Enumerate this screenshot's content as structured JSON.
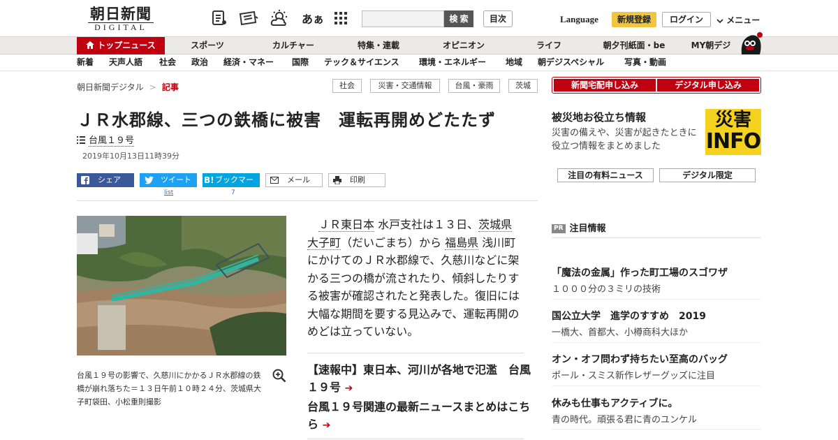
{
  "header": {
    "logo_main": "朝日新聞",
    "logo_sub": "DIGITAL",
    "search_label": "検 索",
    "search_placeholder": "",
    "toc_label": "目次",
    "font_icon_text": "あぁ",
    "language": "Language",
    "register": "新規登録",
    "login": "ログイン",
    "menu": "メニュー"
  },
  "nav1": [
    {
      "label": "トップニュース"
    },
    {
      "label": "スポーツ"
    },
    {
      "label": "カルチャー"
    },
    {
      "label": "特集・連載"
    },
    {
      "label": "オピニオン"
    },
    {
      "label": "ライフ"
    },
    {
      "label": "朝夕刊紙面・be"
    },
    {
      "label": "MY朝デジ"
    }
  ],
  "nav2": [
    {
      "label": "新着"
    },
    {
      "label": "天声人語"
    },
    {
      "label": "社会"
    },
    {
      "label": "政治"
    },
    {
      "label": "経済・マネー"
    },
    {
      "label": "国際"
    },
    {
      "label": "テック＆サイエンス"
    },
    {
      "label": "環境・エネルギー"
    },
    {
      "label": "地域"
    },
    {
      "label": "朝デジスペシャル"
    },
    {
      "label": "写真・動画"
    }
  ],
  "breadcrumb": {
    "home": "朝日新聞デジタル",
    "sep": ">",
    "current": "記事"
  },
  "tags": [
    "社会",
    "災害・交通情報",
    "台風・豪雨",
    "茨城"
  ],
  "subscribe": {
    "delivery": "新聞宅配申し込み",
    "digital": "デジタル申し込み"
  },
  "article": {
    "title": "ＪＲ水郡線、三つの鉄橋に被害　運転再開めどたたず",
    "topic": "台風１９号",
    "date": "2019年10月13日11時39分",
    "share": {
      "facebook": "シェア",
      "twitter": "ツイート",
      "twitter_count": "list",
      "hatena": "ブックマーク",
      "hatena_count": "7",
      "mail": "メール",
      "print": "印刷"
    },
    "caption": "台風１９号の影響で、久慈川にかかるＪＲ水郡線の鉄橋が崩れ落ちた＝１３日午前１０時２４分、茨城県大子町袋田、小松重則撮影",
    "body": {
      "p1": "ＪＲ東日本",
      "p2": " 水戸支社は１３日、",
      "p3": "茨城県",
      "p4": " ",
      "p5": "大子町",
      "p6": "（だいごまち）から ",
      "p7": "福島県",
      "p8": " 浅川町にかけてのＪＲ水郡線で、久慈川などに架かる三つの橋が流されたり、傾斜したりする被害が確認されたと発表した。復旧には大幅な期間を要する見込みで、運転再開のめどは立っていない。"
    },
    "related": [
      {
        "label": "【速報中】東日本、河川が各地で氾濫　台風１９号"
      },
      {
        "label": "台風１９号関連の最新ニュースまとめはこちら"
      }
    ]
  },
  "sidebar": {
    "disaster_title": "被災地お役立ち情報",
    "disaster_desc": "災害の備えや、災害が起きたときに役立つ情報をまとめました",
    "disaster_badge_top": "災害",
    "disaster_badge_bottom": "INFO",
    "box1": "注目の有料ニュース",
    "box2": "デジタル限定",
    "pr_badge": "PR",
    "pr_head": "注目情報",
    "pr_items": [
      {
        "title": "「魔法の金属」作った町工場のスゴワザ",
        "sub": "１０００分の３ミリの技術"
      },
      {
        "title": "国公立大学　進学のすすめ　2019",
        "sub": "一橋大、首都大、小樽商科大ほか"
      },
      {
        "title": "オン・オフ問わず持ちたい至高のバッグ",
        "sub": "ポール・スミス新作レザーグッズに注目"
      },
      {
        "title": "休みも仕事もアクティブに。",
        "sub": "青の時代。頑張る君に青のユンケル"
      }
    ]
  },
  "colors": {
    "brand_red": "#c00010",
    "facebook": "#3b5998",
    "twitter": "#1da1f2",
    "hatena": "#00a4de",
    "badge_yellow": "#f5d21e"
  }
}
